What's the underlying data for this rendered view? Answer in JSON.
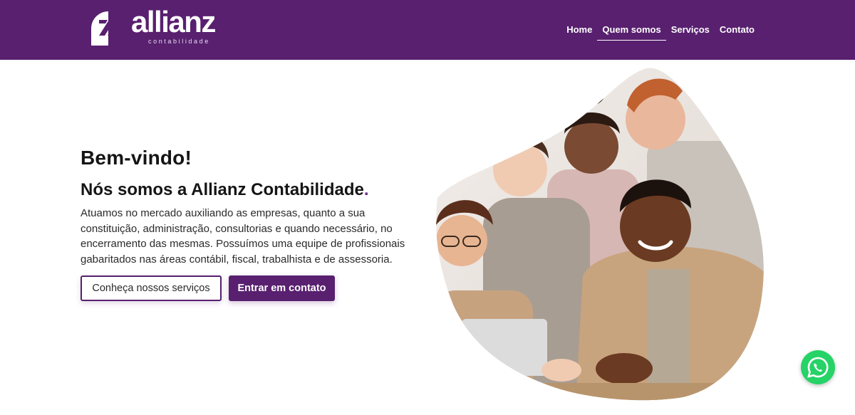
{
  "header": {
    "logo": {
      "wordmark": "allianz",
      "subtitle": "contabilidade"
    },
    "nav": [
      {
        "label": "Home",
        "active": false
      },
      {
        "label": "Quem somos",
        "active": true
      },
      {
        "label": "Serviços",
        "active": false
      },
      {
        "label": "Contato",
        "active": false
      }
    ]
  },
  "hero": {
    "welcome": "Bem-vindo!",
    "headline": "Nós somos a Allianz Contabilidade",
    "headline_dot": ".",
    "description": "Atuamos no mercado auxiliando as empresas, quanto a sua constituição, administração, consultorias e quando necessário, no encerramento das mesmas. Possuímos uma equipe de profissionais gabaritados nas áreas contábil, fiscal, trabalhista e de assessoria.",
    "primary_button": "Conheça nossos serviços",
    "secondary_button": "Entrar em contato"
  },
  "photo": {
    "icon": "team-photo"
  },
  "floating": {
    "icon": "whatsapp-icon"
  },
  "colors": {
    "brand": "#58206f",
    "accent": "#6a2b88",
    "whatsapp": "#25d366"
  }
}
